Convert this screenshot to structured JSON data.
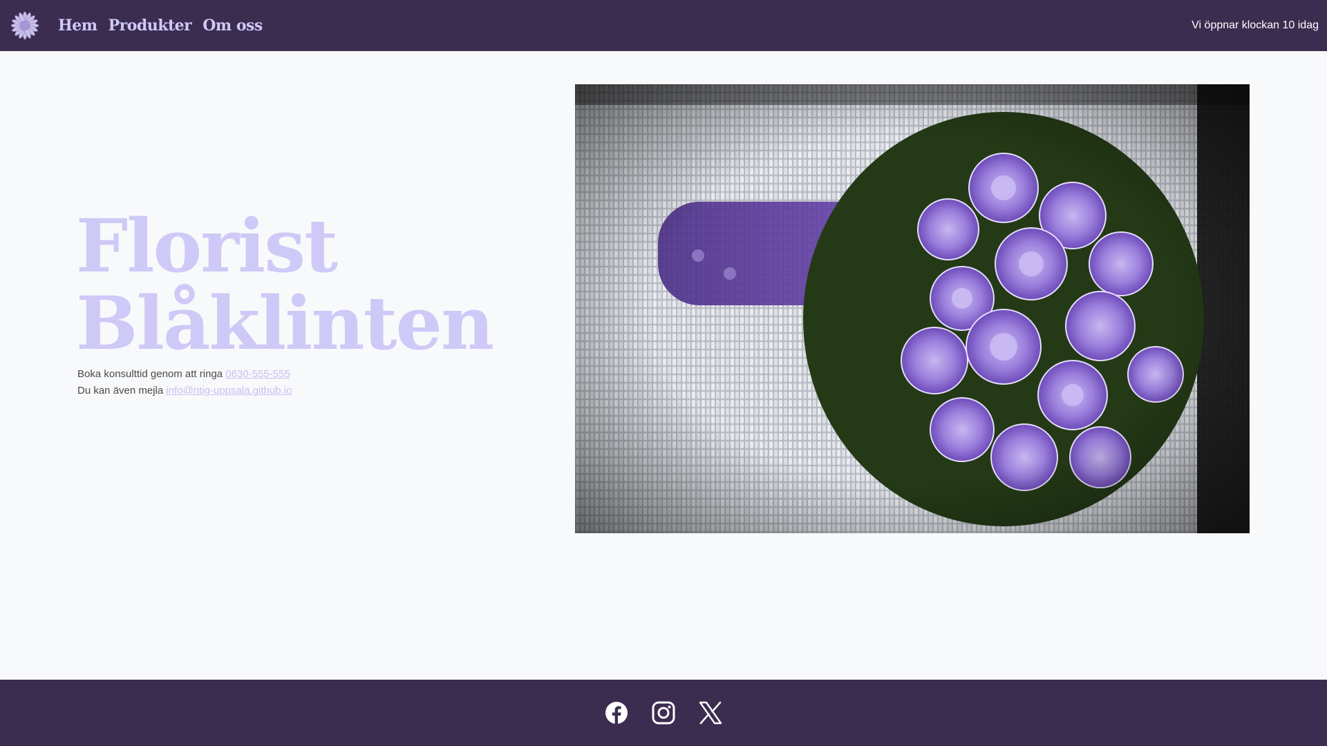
{
  "header": {
    "logo_icon": "flower-logo-icon",
    "nav": [
      {
        "label": "Hem"
      },
      {
        "label": "Produkter"
      },
      {
        "label": "Om oss"
      }
    ],
    "opening_note": "Vi öppnar klockan 10 idag"
  },
  "hero": {
    "title_line1": "Florist",
    "title_line2": "Blåklinten",
    "contact_call_text": "Boka konsulttid genom att ringa",
    "phone": "0630-555-555",
    "contact_mail_text": "Du kan även mejla",
    "email": "info@ntig-uppsala.github.io",
    "image_icon": "lilac-bouquet-photo"
  },
  "footer": {
    "social": [
      {
        "icon": "facebook-icon"
      },
      {
        "icon": "instagram-icon"
      },
      {
        "icon": "x-twitter-icon"
      }
    ]
  },
  "colors": {
    "header_bg": "#3b2d50",
    "accent_lavender": "#cfc9f7",
    "page_bg": "#f8f9fb"
  }
}
